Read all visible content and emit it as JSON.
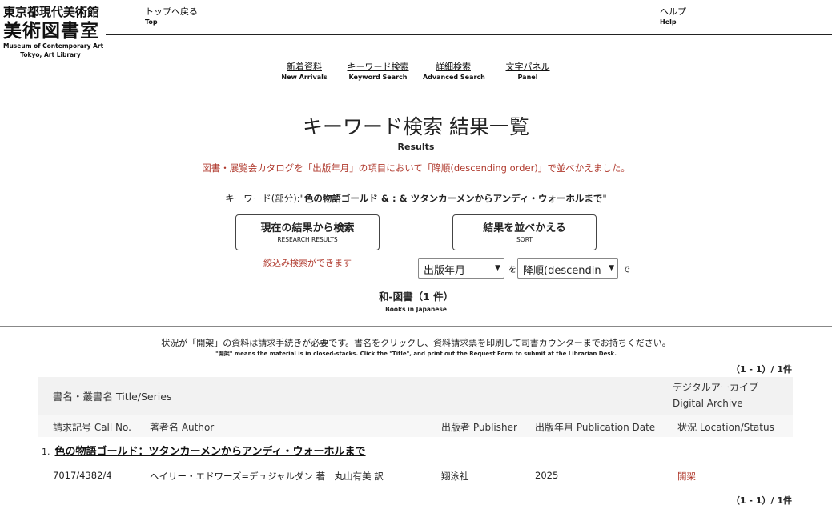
{
  "logo": {
    "line1": "東京都現代美術館",
    "line2": "美術図書室",
    "line3": "Museum of Contemporary Art",
    "line4": "Tokyo, Art Library"
  },
  "top_nav": {
    "back_jp": "トップへ戻る",
    "back_en": "Top",
    "help_jp": "ヘルプ",
    "help_en": "Help"
  },
  "nav": [
    {
      "jp": "新着資料",
      "en": "New Arrivals"
    },
    {
      "jp": "キーワード検索",
      "en": "Keyword Search"
    },
    {
      "jp": "詳細検索",
      "en": "Advanced Search"
    },
    {
      "jp": "文字パネル",
      "en": "Panel"
    }
  ],
  "page": {
    "title": "キーワード検索 結果一覧",
    "subtitle": "Results",
    "notice": "図書・展覧会カタログを「出版年月」の項目において「降順(descending order)」で並べかえました。",
    "keyword_label": "キーワード(部分):\"",
    "keyword_value": "色の物語ゴールド & : & ツタンカーメンからアンディ・ウォーホルまで",
    "keyword_end": "\""
  },
  "buttons": {
    "research_jp": "現在の結果から検索",
    "research_en": "RESEARCH RESULTS",
    "sort_jp": "結果を並べかえる",
    "sort_en": "SORT",
    "filter_note": "絞込み検索ができます"
  },
  "sort": {
    "field_value": "出版年月",
    "wo": "を",
    "order_value": "降順(descendin",
    "de": "で"
  },
  "section": {
    "title": "和-図書（1 件）",
    "subtitle": "Books in Japanese"
  },
  "status_note": {
    "jp": "状況が「開架」の資料は請求手続きが必要です。書名をクリックし、資料請求票を印刷して司書カウンターまでお持ちください。",
    "en": "\"開架\" means the material is in closed-stacks. Click the \"Title\", and print out the Request Form to submit at the Librarian Desk."
  },
  "count": "（1 - 1）/ 1件",
  "table": {
    "headers": {
      "title_series": "書名・叢書名 Title/Series",
      "digital_archive_jp": "デジタルアーカイブ",
      "digital_archive_en": "Digital Archive",
      "call_no": "請求記号 Call No.",
      "author": "著者名 Author",
      "publisher": "出版者 Publisher",
      "pub_date": "出版年月 Publication Date",
      "status": "状況 Location/Status"
    },
    "rows": [
      {
        "num": "1.",
        "title": "色の物語ゴールド：ツタンカーメンからアンディ・ウォーホルまで",
        "call_no": "7017/4382/4",
        "author": "ヘイリー・エドワーズ=デュジャルダン 著　丸山有美 訳",
        "publisher": "翔泳社",
        "pub_date": "2025",
        "status": "開架"
      }
    ]
  }
}
